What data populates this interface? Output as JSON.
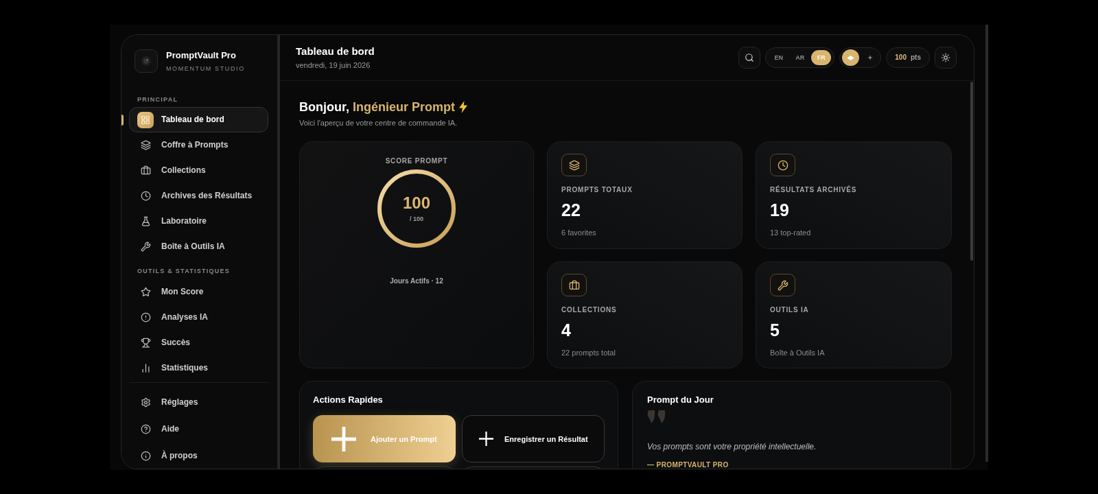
{
  "sidebar": {
    "brand": {
      "name": "PromptVault Pro",
      "subtitle": "MOMENTUM STUDIO"
    },
    "sections": [
      {
        "title": "PRINCIPAL",
        "items": [
          {
            "label": "Tableau de bord",
            "selected": true
          },
          {
            "label": "Coffre à Prompts",
            "selected": false
          },
          {
            "label": "Collections",
            "selected": false
          },
          {
            "label": "Archives des Résultats",
            "selected": false
          },
          {
            "label": "Laboratoire",
            "selected": false
          },
          {
            "label": "Boîte à Outils IA",
            "selected": false
          }
        ]
      },
      {
        "title": "OUTILS & STATISTIQUES",
        "items": [
          {
            "label": "Mon Score",
            "selected": false
          },
          {
            "label": "Analyses IA",
            "selected": false
          },
          {
            "label": "Succès",
            "selected": false
          },
          {
            "label": "Statistiques",
            "selected": false
          }
        ]
      }
    ],
    "footer_items": [
      {
        "label": "Réglages",
        "selected": false
      },
      {
        "label": "Aide",
        "selected": false
      },
      {
        "label": "À propos",
        "selected": false
      }
    ]
  },
  "header": {
    "title": "Tableau de bord",
    "date": "vendredi, 19 juin 2026",
    "languages": [
      {
        "label": "EN",
        "selected": false
      },
      {
        "label": "AR",
        "selected": false
      },
      {
        "label": "FR",
        "selected": true
      }
    ],
    "themes": [
      {
        "kind": "diamond",
        "selected": true
      },
      {
        "kind": "sparkle",
        "selected": false
      }
    ],
    "points": {
      "value": "100",
      "unit": "pts"
    }
  },
  "greeting": {
    "text": "Bonjour,",
    "name": "Ingénieur Prompt"
  },
  "subtitle": "Voici l'aperçu de votre centre de commande IA.",
  "score": {
    "label": "SCORE PROMPT",
    "value": "100",
    "max": "/ 100",
    "level": 1,
    "footer": "Jours Actifs · 12"
  },
  "stats": [
    {
      "label": "PROMPTS TOTAUX",
      "value": "22",
      "note": "6 favorites"
    },
    {
      "label": "RÉSULTATS ARCHIVÉS",
      "value": "19",
      "note": "13 top-rated"
    },
    {
      "label": "COLLECTIONS",
      "value": "4",
      "note": "22 prompts total"
    },
    {
      "label": "OUTILS IA",
      "value": "5",
      "note": "Boîte à Outils IA"
    }
  ],
  "quick_actions": {
    "title": "Actions Rapides",
    "buttons": [
      {
        "label": "Ajouter un Prompt",
        "kind": "primary"
      },
      {
        "label": "Enregistrer un Résultat",
        "kind": "secondary"
      },
      {
        "kind": "secondary"
      },
      {
        "kind": "secondary"
      }
    ]
  },
  "prompt_of_day": {
    "title": "Prompt du Jour",
    "quote": "Vos prompts sont votre propriété intellectuelle.",
    "author": "— PROMPTVAULT PRO"
  }
}
